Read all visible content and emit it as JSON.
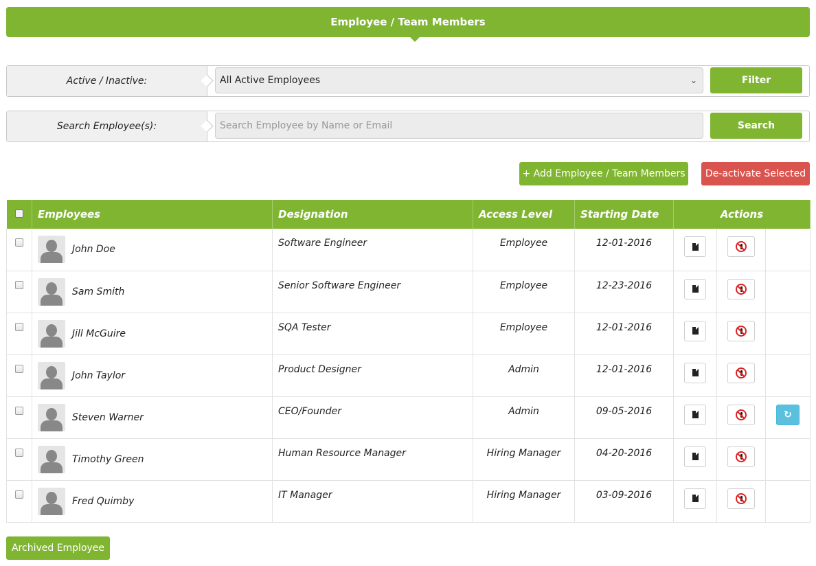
{
  "header": {
    "title": "Employee / Team Members"
  },
  "filter": {
    "label": "Active / Inactive:",
    "selected": "All Active Employees",
    "button": "Filter"
  },
  "search": {
    "label": "Search Employee(s):",
    "placeholder": "Search Employee by Name or Email",
    "value": "",
    "button": "Search"
  },
  "actions": {
    "add_label": "+ Add Employee / Team Members",
    "deactivate_label": "De-activate Selected"
  },
  "table": {
    "columns": [
      "Employees",
      "Designation",
      "Access Level",
      "Starting Date",
      "Actions"
    ],
    "rows": [
      {
        "name": "John Doe",
        "designation": "Software Engineer",
        "access": "Employee",
        "date": "12-01-2016",
        "restore": false
      },
      {
        "name": "Sam Smith",
        "designation": "Senior Software Engineer",
        "access": "Employee",
        "date": "12-23-2016",
        "restore": false
      },
      {
        "name": "Jill McGuire",
        "designation": "SQA Tester",
        "access": "Employee",
        "date": "12-01-2016",
        "restore": false
      },
      {
        "name": "John Taylor",
        "designation": "Product Designer",
        "access": "Admin",
        "date": "12-01-2016",
        "restore": false
      },
      {
        "name": "Steven Warner",
        "designation": "CEO/Founder",
        "access": "Admin",
        "date": "09-05-2016",
        "restore": true
      },
      {
        "name": "Timothy Green",
        "designation": "Human Resource Manager",
        "access": "Hiring Manager",
        "date": "04-20-2016",
        "restore": false
      },
      {
        "name": "Fred Quimby",
        "designation": "IT Manager",
        "access": "Hiring Manager",
        "date": "03-09-2016",
        "restore": false
      }
    ]
  },
  "footer": {
    "archived_label": "Archived Employee"
  },
  "icons": {
    "view": "document-icon",
    "deactivate": "deactivate-user-icon",
    "restore": "restore-icon",
    "avatar": "user-silhouette-icon"
  },
  "colors": {
    "primary_green": "#80b532",
    "danger_red": "#d9534f",
    "info_blue": "#5bc0de"
  }
}
